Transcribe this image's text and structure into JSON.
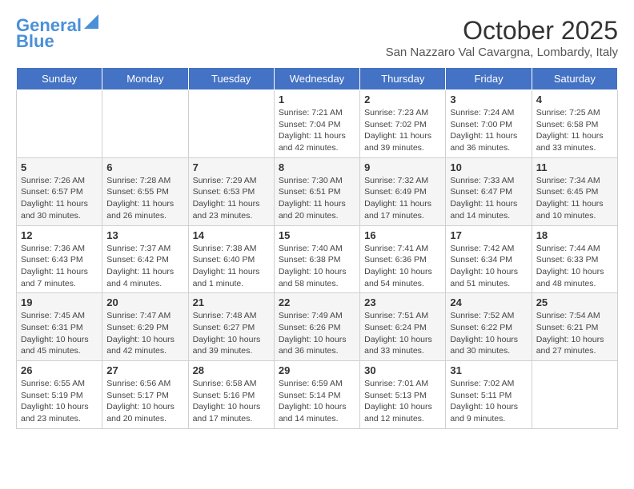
{
  "header": {
    "logo_line1": "General",
    "logo_line2": "Blue",
    "month_title": "October 2025",
    "location": "San Nazzaro Val Cavargna, Lombardy, Italy"
  },
  "days_of_week": [
    "Sunday",
    "Monday",
    "Tuesday",
    "Wednesday",
    "Thursday",
    "Friday",
    "Saturday"
  ],
  "weeks": [
    [
      {
        "day": "",
        "info": ""
      },
      {
        "day": "",
        "info": ""
      },
      {
        "day": "",
        "info": ""
      },
      {
        "day": "1",
        "info": "Sunrise: 7:21 AM\nSunset: 7:04 PM\nDaylight: 11 hours and 42 minutes."
      },
      {
        "day": "2",
        "info": "Sunrise: 7:23 AM\nSunset: 7:02 PM\nDaylight: 11 hours and 39 minutes."
      },
      {
        "day": "3",
        "info": "Sunrise: 7:24 AM\nSunset: 7:00 PM\nDaylight: 11 hours and 36 minutes."
      },
      {
        "day": "4",
        "info": "Sunrise: 7:25 AM\nSunset: 6:58 PM\nDaylight: 11 hours and 33 minutes."
      }
    ],
    [
      {
        "day": "5",
        "info": "Sunrise: 7:26 AM\nSunset: 6:57 PM\nDaylight: 11 hours and 30 minutes."
      },
      {
        "day": "6",
        "info": "Sunrise: 7:28 AM\nSunset: 6:55 PM\nDaylight: 11 hours and 26 minutes."
      },
      {
        "day": "7",
        "info": "Sunrise: 7:29 AM\nSunset: 6:53 PM\nDaylight: 11 hours and 23 minutes."
      },
      {
        "day": "8",
        "info": "Sunrise: 7:30 AM\nSunset: 6:51 PM\nDaylight: 11 hours and 20 minutes."
      },
      {
        "day": "9",
        "info": "Sunrise: 7:32 AM\nSunset: 6:49 PM\nDaylight: 11 hours and 17 minutes."
      },
      {
        "day": "10",
        "info": "Sunrise: 7:33 AM\nSunset: 6:47 PM\nDaylight: 11 hours and 14 minutes."
      },
      {
        "day": "11",
        "info": "Sunrise: 7:34 AM\nSunset: 6:45 PM\nDaylight: 11 hours and 10 minutes."
      }
    ],
    [
      {
        "day": "12",
        "info": "Sunrise: 7:36 AM\nSunset: 6:43 PM\nDaylight: 11 hours and 7 minutes."
      },
      {
        "day": "13",
        "info": "Sunrise: 7:37 AM\nSunset: 6:42 PM\nDaylight: 11 hours and 4 minutes."
      },
      {
        "day": "14",
        "info": "Sunrise: 7:38 AM\nSunset: 6:40 PM\nDaylight: 11 hours and 1 minute."
      },
      {
        "day": "15",
        "info": "Sunrise: 7:40 AM\nSunset: 6:38 PM\nDaylight: 10 hours and 58 minutes."
      },
      {
        "day": "16",
        "info": "Sunrise: 7:41 AM\nSunset: 6:36 PM\nDaylight: 10 hours and 54 minutes."
      },
      {
        "day": "17",
        "info": "Sunrise: 7:42 AM\nSunset: 6:34 PM\nDaylight: 10 hours and 51 minutes."
      },
      {
        "day": "18",
        "info": "Sunrise: 7:44 AM\nSunset: 6:33 PM\nDaylight: 10 hours and 48 minutes."
      }
    ],
    [
      {
        "day": "19",
        "info": "Sunrise: 7:45 AM\nSunset: 6:31 PM\nDaylight: 10 hours and 45 minutes."
      },
      {
        "day": "20",
        "info": "Sunrise: 7:47 AM\nSunset: 6:29 PM\nDaylight: 10 hours and 42 minutes."
      },
      {
        "day": "21",
        "info": "Sunrise: 7:48 AM\nSunset: 6:27 PM\nDaylight: 10 hours and 39 minutes."
      },
      {
        "day": "22",
        "info": "Sunrise: 7:49 AM\nSunset: 6:26 PM\nDaylight: 10 hours and 36 minutes."
      },
      {
        "day": "23",
        "info": "Sunrise: 7:51 AM\nSunset: 6:24 PM\nDaylight: 10 hours and 33 minutes."
      },
      {
        "day": "24",
        "info": "Sunrise: 7:52 AM\nSunset: 6:22 PM\nDaylight: 10 hours and 30 minutes."
      },
      {
        "day": "25",
        "info": "Sunrise: 7:54 AM\nSunset: 6:21 PM\nDaylight: 10 hours and 27 minutes."
      }
    ],
    [
      {
        "day": "26",
        "info": "Sunrise: 6:55 AM\nSunset: 5:19 PM\nDaylight: 10 hours and 23 minutes."
      },
      {
        "day": "27",
        "info": "Sunrise: 6:56 AM\nSunset: 5:17 PM\nDaylight: 10 hours and 20 minutes."
      },
      {
        "day": "28",
        "info": "Sunrise: 6:58 AM\nSunset: 5:16 PM\nDaylight: 10 hours and 17 minutes."
      },
      {
        "day": "29",
        "info": "Sunrise: 6:59 AM\nSunset: 5:14 PM\nDaylight: 10 hours and 14 minutes."
      },
      {
        "day": "30",
        "info": "Sunrise: 7:01 AM\nSunset: 5:13 PM\nDaylight: 10 hours and 12 minutes."
      },
      {
        "day": "31",
        "info": "Sunrise: 7:02 AM\nSunset: 5:11 PM\nDaylight: 10 hours and 9 minutes."
      },
      {
        "day": "",
        "info": ""
      }
    ]
  ]
}
